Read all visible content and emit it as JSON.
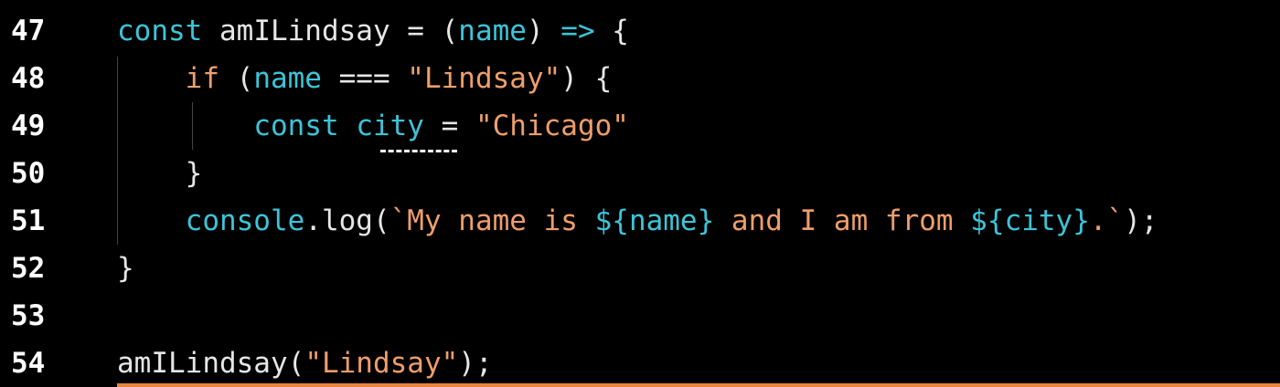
{
  "editor": {
    "lines": [
      {
        "number": "47",
        "tokens": [
          {
            "t": "const",
            "c": "kw"
          },
          {
            "t": " amILindsay = (",
            "c": "plain"
          },
          {
            "t": "name",
            "c": "kw"
          },
          {
            "t": ") ",
            "c": "plain"
          },
          {
            "t": "=>",
            "c": "kw"
          },
          {
            "t": " {",
            "c": "plain"
          }
        ]
      },
      {
        "number": "48",
        "tokens": [
          {
            "t": "    ",
            "c": "plain"
          },
          {
            "t": "if",
            "c": "str"
          },
          {
            "t": " (",
            "c": "plain"
          },
          {
            "t": "name",
            "c": "kw"
          },
          {
            "t": " === ",
            "c": "plain"
          },
          {
            "t": "\"Lindsay\"",
            "c": "str"
          },
          {
            "t": ") {",
            "c": "plain"
          }
        ]
      },
      {
        "number": "49",
        "tokens": [
          {
            "t": "        ",
            "c": "plain"
          },
          {
            "t": "const",
            "c": "kw"
          },
          {
            "t": " ",
            "c": "plain"
          },
          {
            "t": "city",
            "c": "kw"
          },
          {
            "t": " = ",
            "c": "plain"
          },
          {
            "t": "\"Chicago\"",
            "c": "str"
          }
        ]
      },
      {
        "number": "50",
        "tokens": [
          {
            "t": "    }",
            "c": "plain"
          }
        ]
      },
      {
        "number": "51",
        "tokens": [
          {
            "t": "    ",
            "c": "plain"
          },
          {
            "t": "console",
            "c": "kw"
          },
          {
            "t": ".log(",
            "c": "plain"
          },
          {
            "t": "`My name is ",
            "c": "str"
          },
          {
            "t": "${",
            "c": "kw"
          },
          {
            "t": "name",
            "c": "kw"
          },
          {
            "t": "}",
            "c": "kw"
          },
          {
            "t": " and I am from ",
            "c": "str"
          },
          {
            "t": "${",
            "c": "kw"
          },
          {
            "t": "city",
            "c": "kw"
          },
          {
            "t": "}",
            "c": "kw"
          },
          {
            "t": ".`",
            "c": "str"
          },
          {
            "t": ");",
            "c": "plain"
          }
        ]
      },
      {
        "number": "52",
        "tokens": [
          {
            "t": "}",
            "c": "plain"
          }
        ]
      },
      {
        "number": "53",
        "tokens": []
      },
      {
        "number": "54",
        "tokens": [
          {
            "t": "amILindsay(",
            "c": "plain"
          },
          {
            "t": "\"Lindsay\"",
            "c": "str"
          },
          {
            "t": ");",
            "c": "plain"
          }
        ]
      }
    ],
    "colors": {
      "background": "#000000",
      "keyword": "#3cc4d8",
      "string": "#ef9e6b",
      "text": "#e6e6e6",
      "current_line_border": "#e8833a"
    }
  }
}
